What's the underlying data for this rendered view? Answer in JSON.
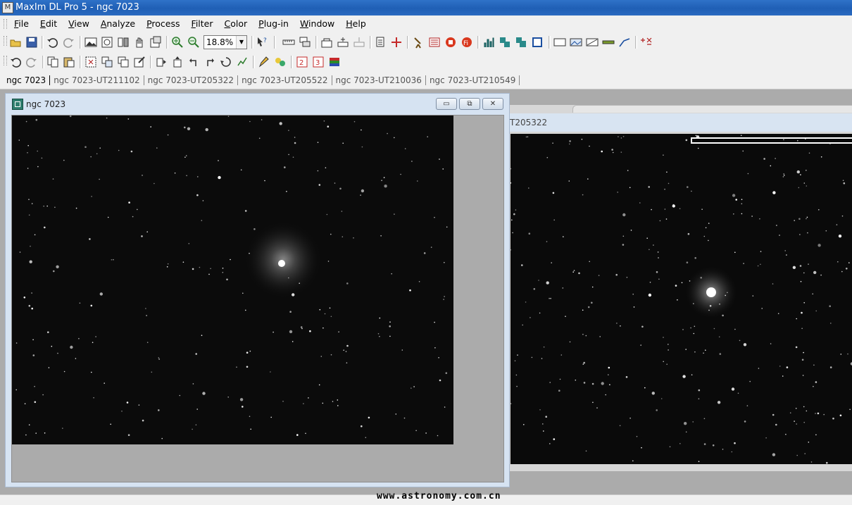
{
  "window": {
    "title": "MaxIm DL Pro 5 - ngc 7023"
  },
  "menu": [
    "File",
    "Edit",
    "View",
    "Analyze",
    "Process",
    "Filter",
    "Color",
    "Plug-in",
    "Window",
    "Help"
  ],
  "toolbar": {
    "zoom_value": "18.8%"
  },
  "doc_tabs": [
    "ngc 7023",
    "ngc 7023-UT211102",
    "ngc 7023-UT205322",
    "ngc 7023-UT205522",
    "ngc 7023-UT210036",
    "ngc 7023-UT210549"
  ],
  "image_window_1": {
    "title": "ngc 7023"
  },
  "image_window_2": {
    "title_fragment": "T205322"
  },
  "statusbar": {
    "watermark": "www.astronomy.com.cn"
  },
  "colors": {
    "title_bar": "#1f5fb5",
    "mdi_background": "#ababab",
    "window_frame": "#d6e3f2",
    "image_background": "#0b0b0b"
  }
}
